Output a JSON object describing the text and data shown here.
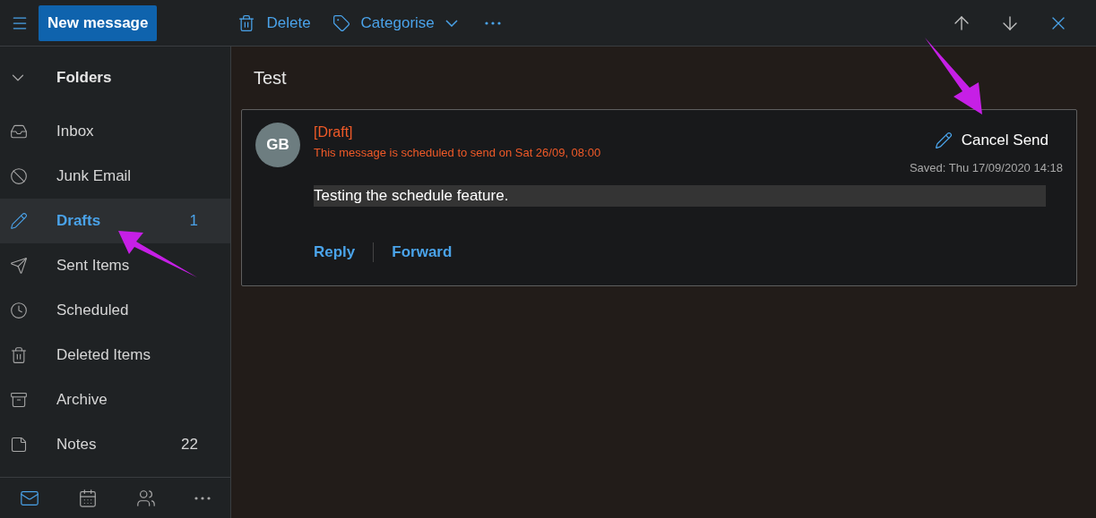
{
  "toolbar": {
    "new_message": "New message",
    "actions": [
      {
        "label": "Delete",
        "kind": "delete"
      },
      {
        "label": "Categorise",
        "kind": "categorise"
      }
    ]
  },
  "sidebar": {
    "heading": "Folders",
    "expanded": true,
    "items": [
      {
        "label": "Inbox",
        "selected": false
      },
      {
        "label": "Junk Email",
        "selected": false
      },
      {
        "label": "Drafts",
        "selected": true,
        "count": "1"
      },
      {
        "label": "Sent Items",
        "selected": false
      },
      {
        "label": "Scheduled",
        "selected": false
      },
      {
        "label": "Deleted Items",
        "selected": false
      },
      {
        "label": "Archive",
        "selected": false
      },
      {
        "label": "Notes",
        "selected": false,
        "count": "22"
      }
    ],
    "bottom_nav": [
      {
        "kind": "mail",
        "selected": true
      },
      {
        "kind": "calendar",
        "selected": false
      },
      {
        "kind": "people",
        "selected": false
      },
      {
        "kind": "more",
        "selected": false
      }
    ]
  },
  "message": {
    "subject": "Test",
    "avatar": "GB",
    "draft_label": "[Draft]",
    "schedule_note": "This message is scheduled to send on Sat 26/09, 08:00",
    "cancel_send": "Cancel Send",
    "saved": "Saved: Thu 17/09/2020 14:18",
    "body": "Testing the schedule feature.",
    "actions": [
      "Reply",
      "Forward"
    ]
  }
}
